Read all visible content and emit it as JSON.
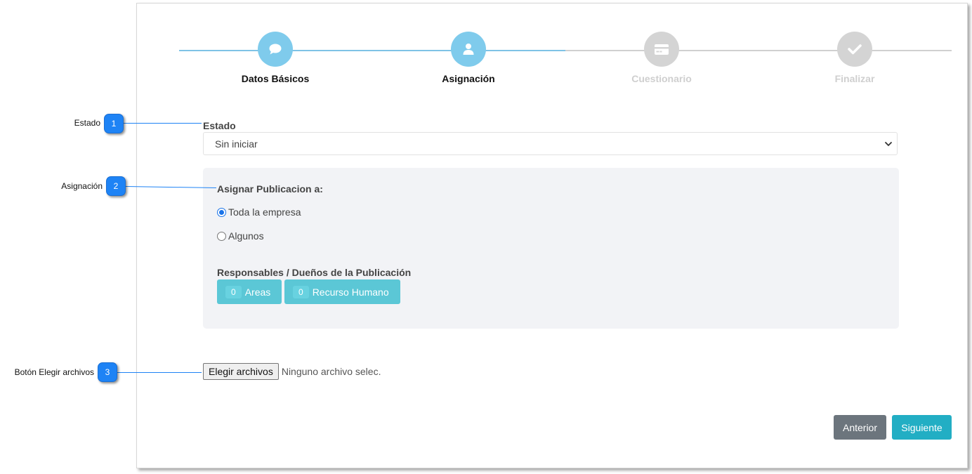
{
  "stepper": {
    "steps": [
      {
        "label": "Datos Básicos",
        "icon": "chat-bubble-icon",
        "state": "active"
      },
      {
        "label": "Asignación",
        "icon": "user-icon",
        "state": "active"
      },
      {
        "label": "Cuestionario",
        "icon": "credit-card-icon",
        "state": "inactive"
      },
      {
        "label": "Finalizar",
        "icon": "checkmark-icon",
        "state": "inactive"
      }
    ],
    "progress_percent": 50
  },
  "estado": {
    "label": "Estado",
    "selected": "Sin iniciar"
  },
  "assignment": {
    "title": "Asignar Publicacion a:",
    "options": [
      {
        "label": "Toda la empresa",
        "checked": true
      },
      {
        "label": "Algunos",
        "checked": false
      }
    ],
    "responsables_title": "Responsables / Dueños de la Publicación",
    "areas": {
      "count": "0",
      "label": "Areas"
    },
    "recurso_humano": {
      "count": "0",
      "label": "Recurso Humano"
    }
  },
  "file_input": {
    "button_label": "Elegir archivos",
    "status": "Ninguno archivo selec."
  },
  "actions": {
    "prev_label": "Anterior",
    "next_label": "Siguiente"
  },
  "callouts": [
    {
      "number": "1",
      "text": "Estado"
    },
    {
      "number": "2",
      "text": "Asignación"
    },
    {
      "number": "3",
      "text": "Botón Elegir archivos"
    }
  ],
  "colors": {
    "step_active": "#7fcbec",
    "step_inactive": "#d4d4d4",
    "info_button": "#5bc7d6",
    "next_button": "#22aec4",
    "prev_button": "#6c757d",
    "callout": "#1e83f5"
  }
}
